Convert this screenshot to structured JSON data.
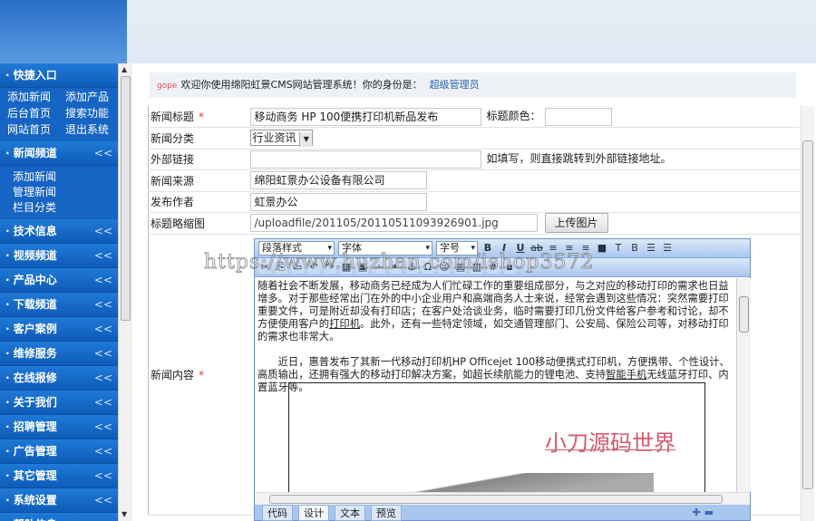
{
  "sidebar": {
    "quick_title": "快捷入口",
    "quick_links": [
      "添加新闻",
      "添加产品",
      "后台首页",
      "搜索功能",
      "网站首页",
      "退出系统"
    ],
    "news_section": {
      "title": "新闻频道",
      "items": [
        "添加新闻",
        "管理新闻",
        "栏目分类"
      ]
    },
    "sections": [
      "技术信息",
      "视频频道",
      "产品中心",
      "下载频道",
      "客户案例",
      "维修服务",
      "在线报修",
      "关于我们",
      "招聘管理",
      "广告管理",
      "其它管理",
      "系统设置",
      "帮助信息"
    ],
    "chevron": "<<"
  },
  "welcome": {
    "tag": "gope",
    "text": "欢迎你使用绵阳虹景CMS网站管理系统！你的身份是：",
    "role": "超级管理员"
  },
  "form": {
    "title_label": "新闻标题",
    "title_value": "移动商务 HP 100便携打印机新品发布",
    "required": "*",
    "color_label": "标题颜色：",
    "color_value": "",
    "category_label": "新闻分类",
    "category_value": "行业资讯",
    "link_label": "外部链接",
    "link_value": "",
    "link_hint": "如填写，则直接跳转到外部链接地址。",
    "source_label": "新闻来源",
    "source_value": "绵阳虹景办公设备有限公司",
    "author_label": "发布作者",
    "author_value": "虹景办公",
    "thumb_label": "标题略缩图",
    "thumb_value": "/uploadfile/201105/20110511093926901.jpg",
    "upload_button": "上传图片",
    "content_label": "新闻内容"
  },
  "editor": {
    "para_style": "段落样式",
    "font": "字体",
    "size": "字号",
    "p1a": "随着社会不断发展，移动商务已经成为人们忙碌工作的重要组成部分，与之对应的移动打印的需求也日益增多。对于那些经常出门在外的中小企业用户和高端商务人士来说，经常会遇到这些情况：突然需要打印重要文件，可是附近却没有打印店；在客户处洽谈业务，临时需要打印几份文件给客户参考和讨论，却不方便使用客户的",
    "p1link": "打印机",
    "p1b": "。此外，还有一些特定领域，如交通管理部门、公安局、保险公司等，对移动打印的需求也非常大。",
    "p2a": "　　近日，惠普发布了其新一代移动打印机HP Officejet 100移动便携式打印机，方便携带、个性设计、高质输出，还拥有强大的移动打印解决方案，如超长续航能力的锂电池、支持",
    "p2link": "智能手机",
    "p2b": "无线蓝牙打印、内置蓝牙等。",
    "image_watermark": "小刀源码世界",
    "tabs": [
      "代码",
      "设计",
      "文本",
      "预览"
    ]
  },
  "watermark": "https://www.huzhan.com/ishop3572"
}
